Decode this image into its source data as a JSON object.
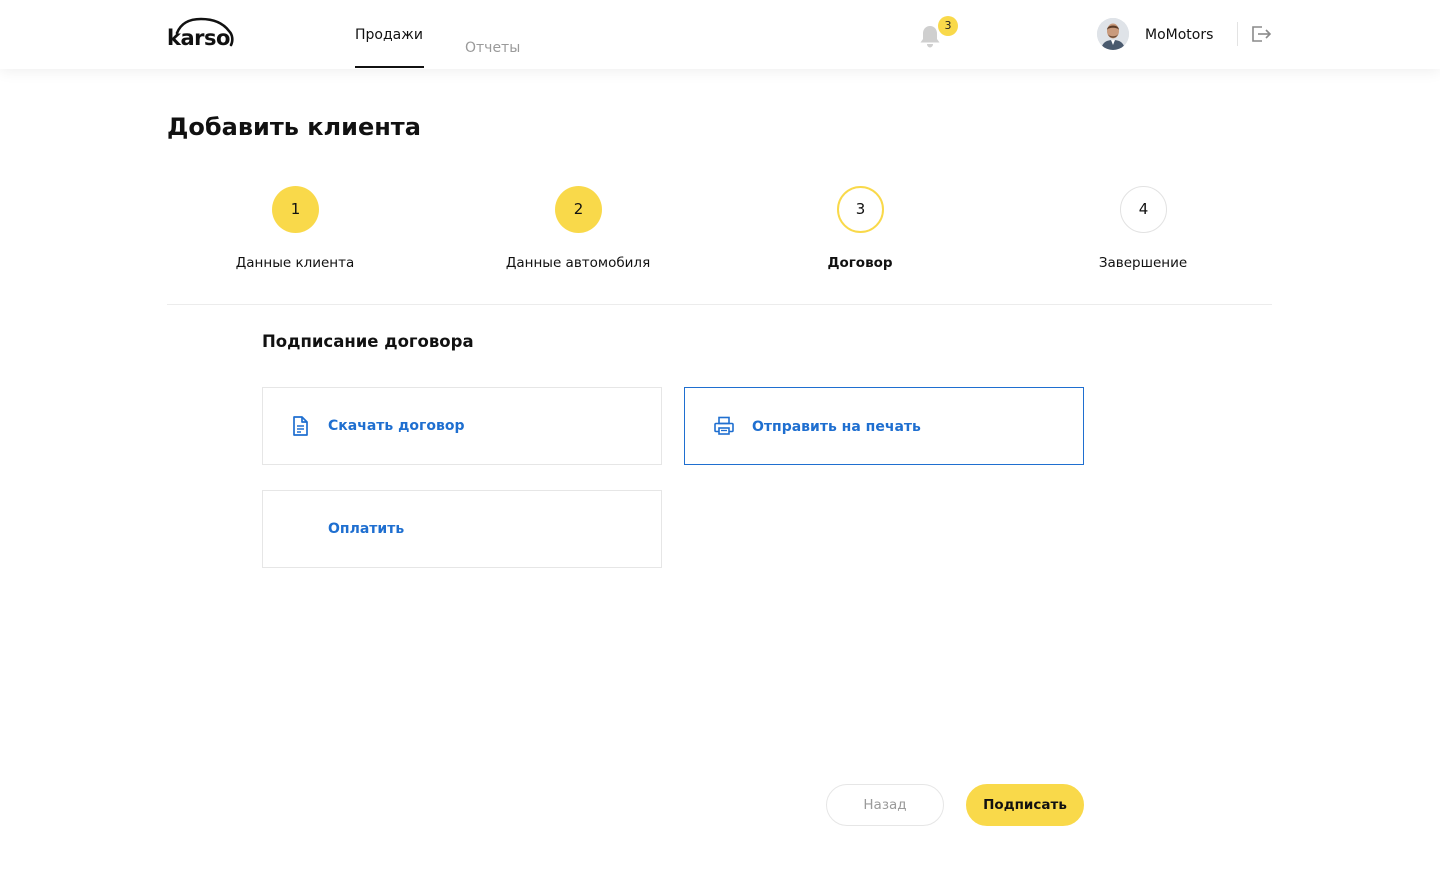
{
  "header": {
    "logo_text": "karso",
    "nav": {
      "sales": "Продажи",
      "reports": "Отчеты"
    },
    "notifications_count": "3",
    "user_name": "MoMotors",
    "icons": {
      "bell": "bell-icon",
      "logout": "logout-icon"
    }
  },
  "page": {
    "title": "Добавить клиента"
  },
  "stepper": {
    "current_step": 3,
    "steps": [
      {
        "number": "1",
        "label": "Данные клиента",
        "state": "done"
      },
      {
        "number": "2",
        "label": "Данные автомобиля",
        "state": "done"
      },
      {
        "number": "3",
        "label": "Договор",
        "state": "active"
      },
      {
        "number": "4",
        "label": "Завершение",
        "state": "pending"
      }
    ]
  },
  "section": {
    "title": "Подписание договора",
    "actions": {
      "download": {
        "label": "Скачать договор",
        "icon": "document-icon"
      },
      "print": {
        "label": "Отправить на печать",
        "icon": "printer-icon",
        "selected": true
      },
      "pay": {
        "label": "Оплатить"
      }
    }
  },
  "footer": {
    "back_label": "Назад",
    "sign_label": "Подписать"
  },
  "colors": {
    "accent_yellow": "#f9d94a",
    "link_blue": "#1f6fd0",
    "text": "#111111",
    "muted": "#9a9a9a"
  }
}
